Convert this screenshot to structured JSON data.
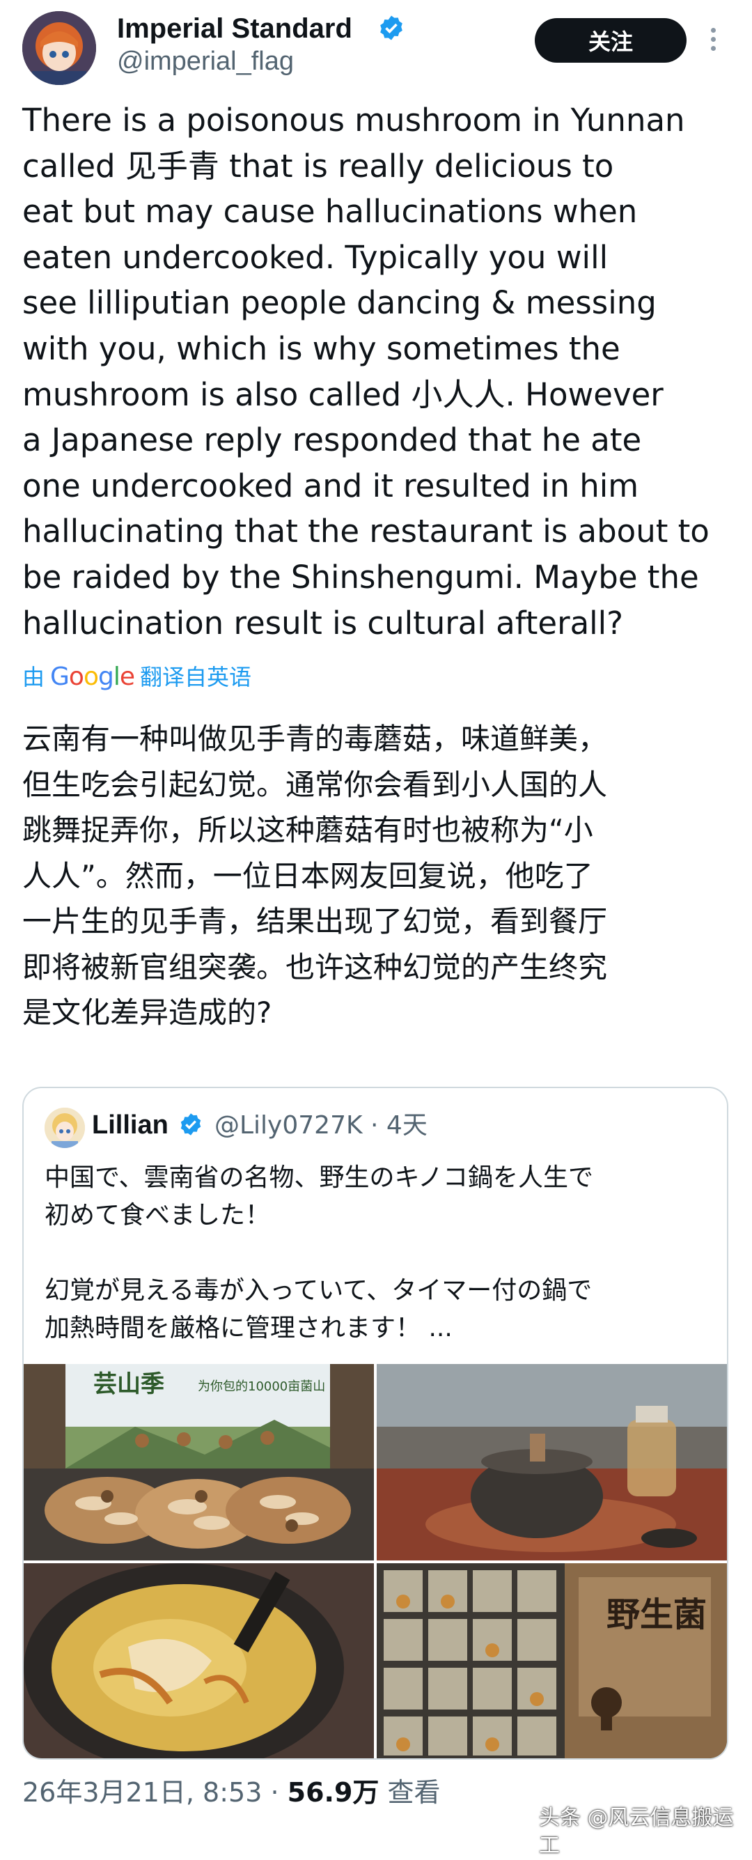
{
  "author": {
    "display_name": "Imperial Standard",
    "handle": "@imperial_flag",
    "follow_label": "关注"
  },
  "tweet": {
    "text_en": "There is a poisonous mushroom in Yunnan\ncalled 见手青 that is really delicious to\neat but may cause hallucinations when\neaten undercooked. Typically you will\nsee lilliputian people dancing & messing\nwith you, which is why sometimes the\nmushroom is also called 小人人. However\na Japanese reply responded that he ate\none undercooked and it resulted in him\nhallucinating that the restaurant is about to\nbe raided by the Shinshengumi. Maybe the\nhallucination result is cultural afterall?",
    "translate_prefix": "由",
    "translate_brand": "Google",
    "translate_suffix": "翻译自英语",
    "text_zh": "云南有一种叫做见手青的毒蘑菇，味道鲜美，\n但生吃会引起幻觉。通常你会看到小人国的人\n跳舞捉弄你，所以这种蘑菇有时也被称为“小\n人人”。然而，一位日本网友回复说，他吃了\n一片生的见手青，结果出现了幻觉，看到餐厅\n即将被新官组突袭。也许这种幻觉的产生终究\n是文化差异造成的?"
  },
  "quote": {
    "name": "Lillian",
    "handle_time": "@Lily0727K · 4天",
    "text": "中国で、雲南省の名物、野生のキノコ鍋を人生で\n初めて食べました！\n\n幻覚が見える毒が入っていて、タイマー付の鍋で\n加熱時間を厳格に管理されます！ ...",
    "photos": {
      "p1_brand": "芸山季",
      "p1_slogan": "为你包的10000亩菌山",
      "p4_sign": "野生菌"
    }
  },
  "footer": {
    "date": "26年3月21日, 8:53 · ",
    "views": "56.9万",
    "views_label": " 查看"
  },
  "watermark": "头条 @风云信息搬运工",
  "colors": {
    "accent": "#1d9bf0",
    "text": "#0f1419",
    "secondary": "#536471",
    "border": "#cfd9de"
  }
}
